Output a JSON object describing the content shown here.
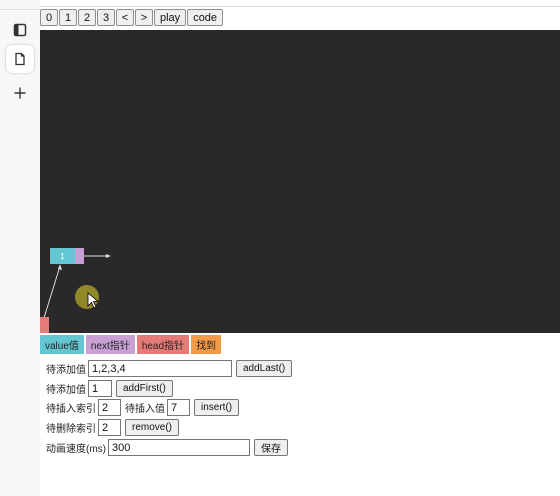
{
  "toolbar": {
    "buttons": [
      "0",
      "1",
      "2",
      "3",
      "<",
      ">",
      "play",
      "code"
    ]
  },
  "canvas": {
    "node_value": "1"
  },
  "legend": [
    {
      "label": "value值",
      "color": "#63c7d3"
    },
    {
      "label": "next指针",
      "color": "#c9a0d6"
    },
    {
      "label": "head指针",
      "color": "#e67a77"
    },
    {
      "label": "找到",
      "color": "#f39a49"
    }
  ],
  "controls": {
    "add_last_label": "待添加值",
    "add_last_value": "1,2,3,4",
    "add_last_button": "addLast()",
    "add_first_label": "待添加值",
    "add_first_value": "1",
    "add_first_button": "addFirst()",
    "insert_index_label": "待插入索引",
    "insert_index_value": "2",
    "insert_value_label": "待插入值",
    "insert_value_value": "7",
    "insert_button": "insert()",
    "remove_label": "待删除索引",
    "remove_value": "2",
    "remove_button": "remove()",
    "speed_label": "动画速度(ms)",
    "speed_value": "300",
    "save_button": "保存"
  }
}
